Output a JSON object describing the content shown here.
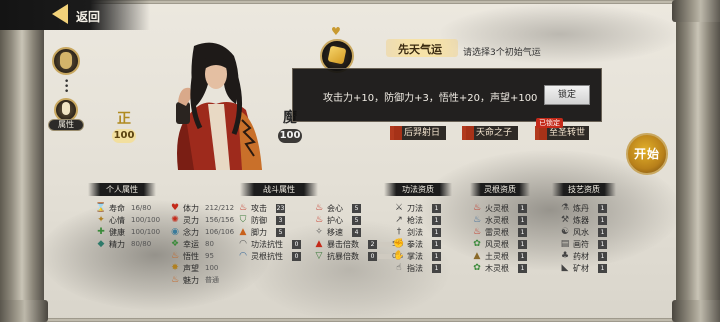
{
  "nav": {
    "back_label": "返回"
  },
  "alignment": {
    "righteous_label": "正",
    "righteous_value": "100",
    "demonic_label": "魔",
    "demonic_value": "100"
  },
  "avatar_panel": {
    "attr_tab_label": "属性"
  },
  "destiny": {
    "title": "先天气运",
    "hint": "请选择3个初始气运",
    "tooltip_text": "攻击力+10，防御力+3，悟性+20，声望+100",
    "lock_label": "锁定",
    "tags": [
      {
        "label": "后羿射日"
      },
      {
        "label": "天命之子"
      },
      {
        "label": "至圣转世",
        "badge": "已锁定"
      }
    ]
  },
  "start_label": "开始",
  "personal": {
    "header": "个人属性",
    "rows": [
      {
        "icon": "hourglass-icon",
        "name": "寿命",
        "value": "16/80"
      },
      {
        "icon": "heart-mind-icon",
        "name": "心情",
        "value": "100/100"
      },
      {
        "icon": "health-cross-icon",
        "name": "健康",
        "value": "100/100"
      },
      {
        "icon": "energy-icon",
        "name": "精力",
        "value": "80/80"
      }
    ]
  },
  "vitals": {
    "rows": [
      {
        "icon": "heart-icon",
        "name": "体力",
        "value": "212/212"
      },
      {
        "icon": "spirit-icon",
        "name": "灵力",
        "value": "156/156"
      },
      {
        "icon": "mind-icon",
        "name": "念力",
        "value": "106/106"
      },
      {
        "icon": "luck-icon",
        "name": "幸运",
        "value": "80"
      },
      {
        "icon": "insight-icon",
        "name": "悟性",
        "value": "95"
      },
      {
        "icon": "fame-icon",
        "name": "声望",
        "value": "100"
      },
      {
        "icon": "charm-icon",
        "name": "魅力",
        "value": "普通"
      }
    ]
  },
  "combat": {
    "header": "战斗属性",
    "col_a": [
      {
        "icon": "attack-icon",
        "name": "攻击",
        "box": "23"
      },
      {
        "icon": "defense-icon",
        "name": "防御",
        "box": "3"
      },
      {
        "icon": "foot-icon",
        "name": "脚力",
        "box": "5"
      },
      {
        "icon": "skill-resist-icon",
        "name": "功法抗性",
        "box": "0"
      },
      {
        "icon": "root-resist-icon",
        "name": "灵根抗性",
        "box": "0"
      }
    ],
    "col_b": [
      {
        "icon": "crit-icon",
        "name": "会心",
        "box": "5"
      },
      {
        "icon": "protect-icon",
        "name": "护心",
        "box": "5"
      },
      {
        "icon": "speed-icon",
        "name": "移速",
        "box": "4"
      },
      {
        "icon": "crit-mult-icon",
        "name": "暴击倍数",
        "box": "2",
        "pct": "5%"
      },
      {
        "icon": "resist-mult-icon",
        "name": "抗暴倍数",
        "box": "0",
        "pct": "0%"
      }
    ]
  },
  "skills": {
    "header": "功法资质",
    "rows": [
      {
        "icon": "blade-icon",
        "name": "刀法",
        "box": "1"
      },
      {
        "icon": "spear-icon",
        "name": "枪法",
        "box": "1"
      },
      {
        "icon": "sword-icon",
        "name": "剑法",
        "box": "1"
      },
      {
        "icon": "fist-icon",
        "name": "拳法",
        "box": "1"
      },
      {
        "icon": "palm-icon",
        "name": "掌法",
        "box": "1"
      },
      {
        "icon": "finger-icon",
        "name": "指法",
        "box": "1"
      }
    ]
  },
  "roots": {
    "header": "灵根资质",
    "rows": [
      {
        "icon": "fire-root-icon",
        "name": "火灵根",
        "box": "1"
      },
      {
        "icon": "water-root-icon",
        "name": "水灵根",
        "box": "1"
      },
      {
        "icon": "thunder-root-icon",
        "name": "雷灵根",
        "box": "1"
      },
      {
        "icon": "wind-root-icon",
        "name": "风灵根",
        "box": "1"
      },
      {
        "icon": "earth-root-icon",
        "name": "土灵根",
        "box": "1"
      },
      {
        "icon": "wood-root-icon",
        "name": "木灵根",
        "box": "1"
      }
    ]
  },
  "arts": {
    "header": "技艺资质",
    "rows": [
      {
        "icon": "alchemy-icon",
        "name": "炼丹",
        "box": "1"
      },
      {
        "icon": "forge-icon",
        "name": "炼器",
        "box": "1"
      },
      {
        "icon": "fengshui-icon",
        "name": "风水",
        "box": "1"
      },
      {
        "icon": "talisman-icon",
        "name": "画符",
        "box": "1"
      },
      {
        "icon": "herb-icon",
        "name": "药材",
        "box": "1"
      },
      {
        "icon": "ore-icon",
        "name": "矿材",
        "box": "1"
      }
    ]
  }
}
